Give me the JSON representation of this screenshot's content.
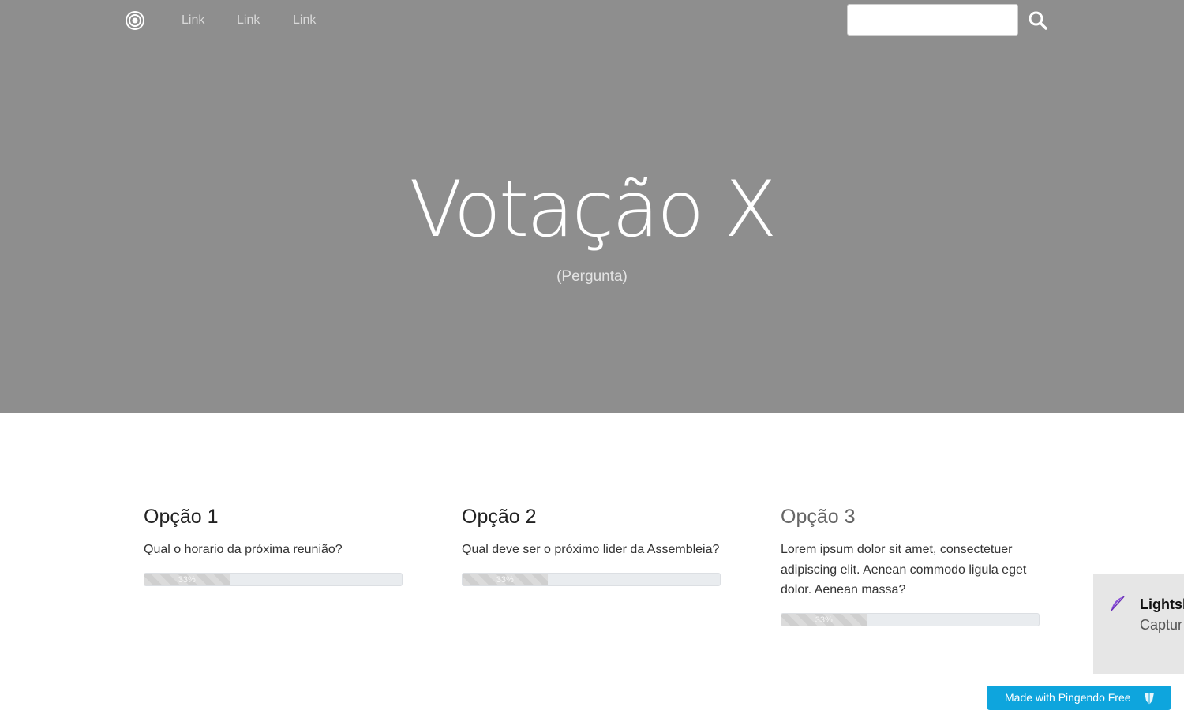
{
  "nav": {
    "brand_icon": "target-icon",
    "links": [
      "Link",
      "Link",
      "Link"
    ],
    "search_placeholder": "",
    "search_icon": "search-icon"
  },
  "hero": {
    "title": "Votação X",
    "subtitle": "(Pergunta)",
    "background": "#8e8e8e"
  },
  "options": [
    {
      "title": "Opção 1",
      "description": "Qual o horario da próxima reunião?",
      "progress_percent": 33,
      "progress_label": "33%"
    },
    {
      "title": "Opção 2",
      "description": "Qual deve ser o próximo lider da Assembleia?",
      "progress_percent": 33,
      "progress_label": "33%"
    },
    {
      "title": "Opção 3",
      "description": "Lorem ipsum dolor sit amet, consectetuer adipiscing elit. Aenean commodo ligula eget dolor. Aenean massa?",
      "progress_percent": 33,
      "progress_label": "33%"
    }
  ],
  "toast": {
    "icon": "feather-icon",
    "title": "Lightsl",
    "body": "Captur aqui pa"
  },
  "pingendo_badge": {
    "label": "Made with Pingendo Free",
    "icon": "pingendo-logo-icon",
    "color": "#0ea5dd"
  }
}
